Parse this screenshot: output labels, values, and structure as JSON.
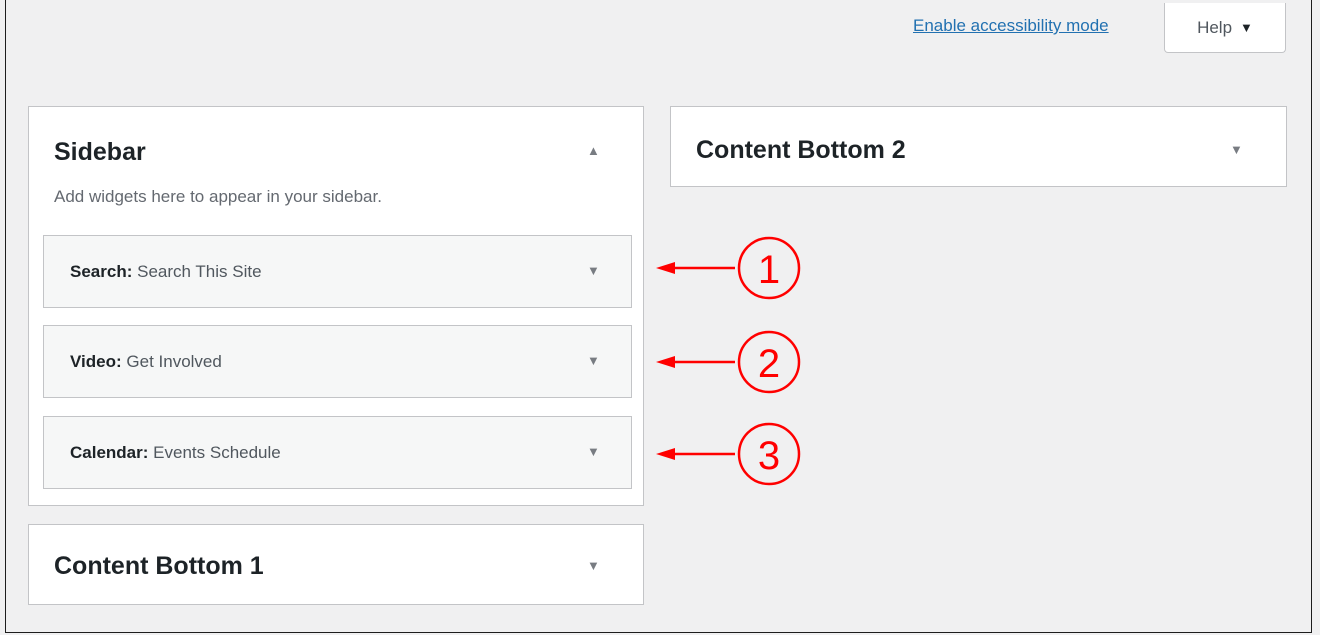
{
  "header": {
    "accessibility_link": "Enable accessibility mode",
    "help_label": "Help",
    "help_caret": "▼"
  },
  "sidebar_area": {
    "title": "Sidebar",
    "toggle": "▲",
    "description": "Add widgets here to appear in your sidebar.",
    "widgets": [
      {
        "type": "Search",
        "name": "Search This Site",
        "toggle": "▼"
      },
      {
        "type": "Video",
        "name": "Get Involved",
        "toggle": "▼"
      },
      {
        "type": "Calendar",
        "name": "Events Schedule",
        "toggle": "▼"
      }
    ]
  },
  "content_bottom_1": {
    "title": "Content Bottom 1",
    "toggle": "▼"
  },
  "content_bottom_2": {
    "title": "Content Bottom 2",
    "toggle": "▼"
  },
  "annotations": {
    "color": "#ff0000",
    "markers": [
      "1",
      "2",
      "3"
    ]
  }
}
